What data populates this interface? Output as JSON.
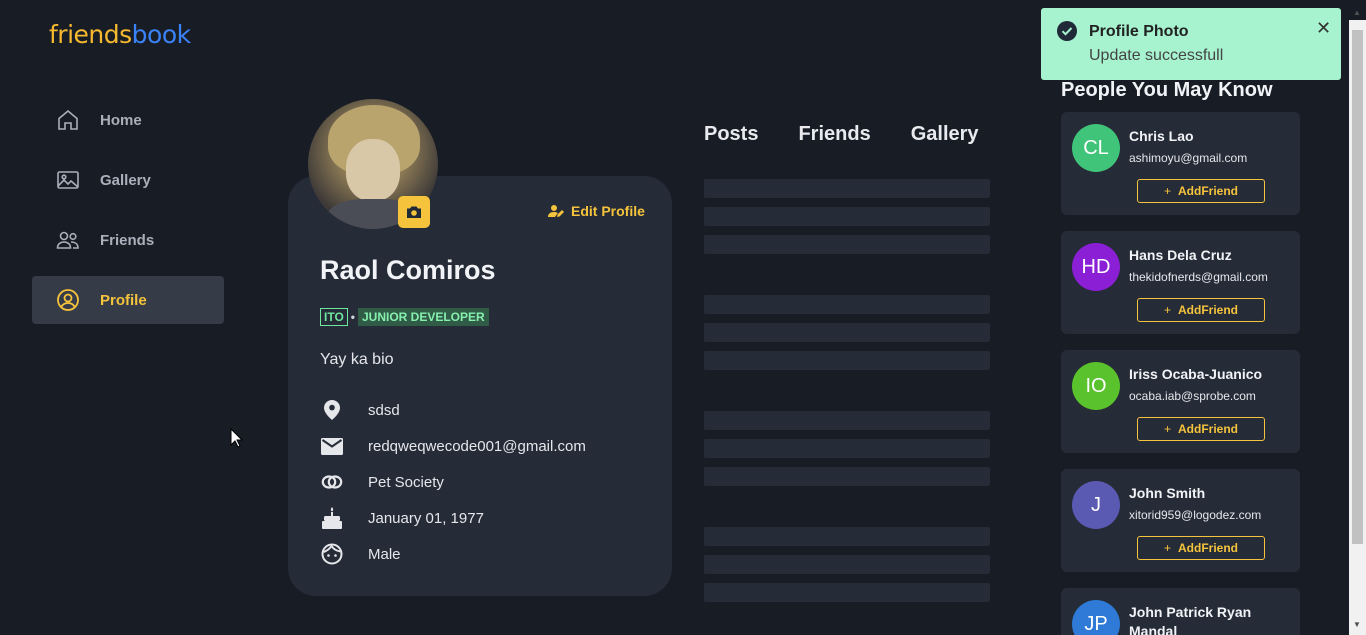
{
  "logo": {
    "part1": "friends",
    "part2": "book"
  },
  "nav": [
    {
      "label": "Home",
      "icon": "home-icon"
    },
    {
      "label": "Gallery",
      "icon": "image-icon"
    },
    {
      "label": "Friends",
      "icon": "users-icon"
    },
    {
      "label": "Profile",
      "icon": "user-circle-icon",
      "active": true
    }
  ],
  "profile": {
    "name": "Raol Comiros",
    "dept": "ITO",
    "role": "JUNIOR DEVELOPER",
    "bio": "Yay ka bio",
    "edit_label": "Edit Profile",
    "info": [
      {
        "icon": "location-pin-icon",
        "text": "sdsd"
      },
      {
        "icon": "mail-icon",
        "text": "redqweqwecode001@gmail.com"
      },
      {
        "icon": "rings-icon",
        "text": "Pet Society"
      },
      {
        "icon": "cake-icon",
        "text": "January 01, 1977"
      },
      {
        "icon": "face-icon",
        "text": "Male"
      }
    ]
  },
  "tabs": [
    "Posts",
    "Friends",
    "Gallery"
  ],
  "toast": {
    "title": "Profile Photo",
    "message": "Update successfull",
    "close": "✕"
  },
  "pymk": {
    "title": "People You May Know",
    "people": [
      {
        "initials": "CL",
        "name": "Chris Lao",
        "email": "ashimoyu@gmail.com",
        "color": "#3fc47a",
        "button": "AddFriend"
      },
      {
        "initials": "HD",
        "name": "Hans Dela Cruz",
        "email": "thekidofnerds@gmail.com",
        "color": "#8b1fd6",
        "button": "AddFriend"
      },
      {
        "initials": "IO",
        "name": "Iriss Ocaba-Juanico",
        "email": "ocaba.iab@sprobe.com",
        "color": "#59c22c",
        "button": "AddFriend"
      },
      {
        "initials": "J",
        "name": "John Smith",
        "email": "xitorid959@logodez.com",
        "color": "#5a5ab3",
        "button": "AddFriend"
      },
      {
        "initials": "JP",
        "name": "John Patrick Ryan Mandal",
        "email": "",
        "color": "#2f7ad6",
        "button": ""
      }
    ]
  },
  "colors": {
    "bg": "#181d25",
    "card": "#252b37",
    "accent": "#f5c33c",
    "toast": "#a7f3d0"
  }
}
